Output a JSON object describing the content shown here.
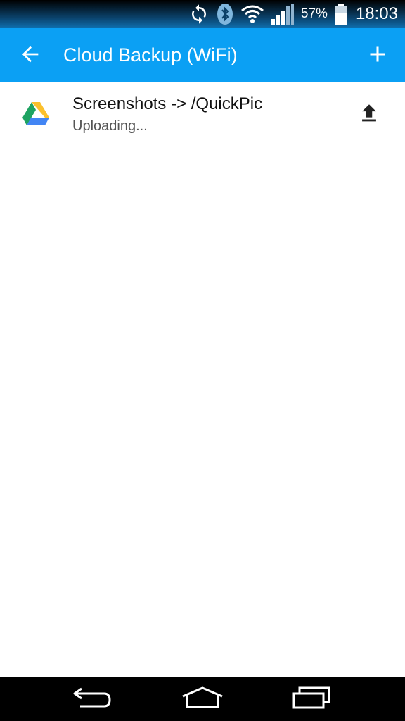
{
  "status_bar": {
    "battery_percent": "57%",
    "time": "18:03",
    "icons": [
      "sync-icon",
      "bluetooth-icon",
      "wifi-icon",
      "signal-icon",
      "battery-icon"
    ]
  },
  "app_bar": {
    "title": "Cloud Backup (WiFi)",
    "back_icon": "arrow-back-icon",
    "add_icon": "plus-icon",
    "color": "#0ba0f4"
  },
  "backups": [
    {
      "icon": "google-drive-icon",
      "title": "Screenshots -> /QuickPic",
      "status": "Uploading...",
      "action_icon": "upload-icon"
    }
  ],
  "nav_bar": {
    "icons": [
      "nav-back-icon",
      "nav-home-icon",
      "nav-recents-icon"
    ]
  }
}
